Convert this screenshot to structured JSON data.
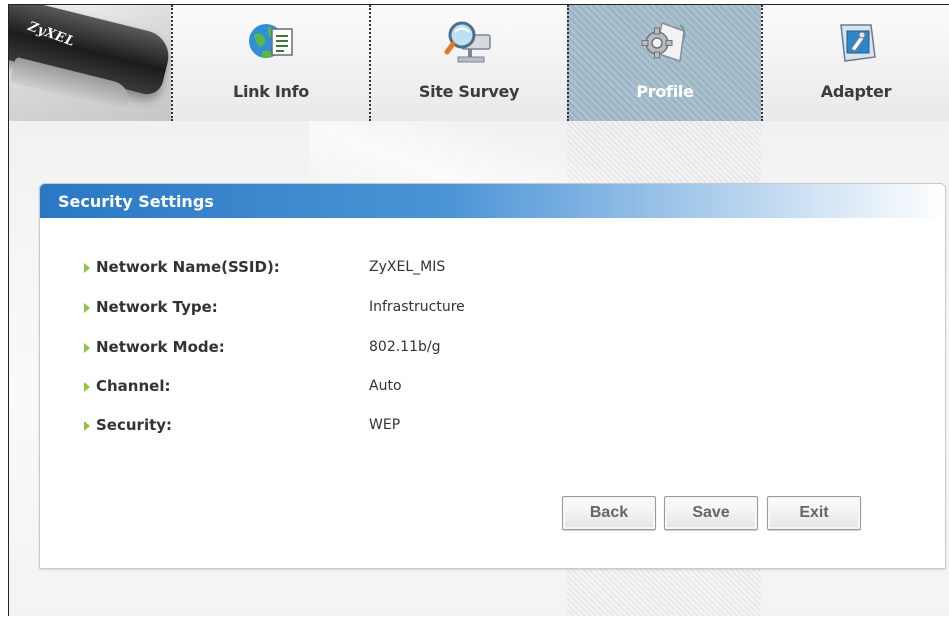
{
  "brand": {
    "logo_text": "ZyXEL"
  },
  "tabs": [
    {
      "label": "Link Info",
      "icon": "globe-document-icon"
    },
    {
      "label": "Site Survey",
      "icon": "magnifier-network-icon"
    },
    {
      "label": "Profile",
      "icon": "gear-document-icon",
      "active": true
    },
    {
      "label": "Adapter",
      "icon": "adapter-icon"
    }
  ],
  "panel": {
    "title": "Security Settings",
    "fields": [
      {
        "label": "Network Name(SSID):",
        "value": "ZyXEL_MIS"
      },
      {
        "label": "Network Type:",
        "value": "Infrastructure"
      },
      {
        "label": "Network Mode:",
        "value": "802.11b/g"
      },
      {
        "label": "Channel:",
        "value": "Auto"
      },
      {
        "label": "Security:",
        "value": "WEP"
      }
    ]
  },
  "buttons": {
    "back": "Back",
    "save": "Save",
    "exit": "Exit"
  },
  "colors": {
    "header_blue": "#2a78c4",
    "active_tab": "#9db6c6",
    "bullet_green": "#8cc63f"
  }
}
